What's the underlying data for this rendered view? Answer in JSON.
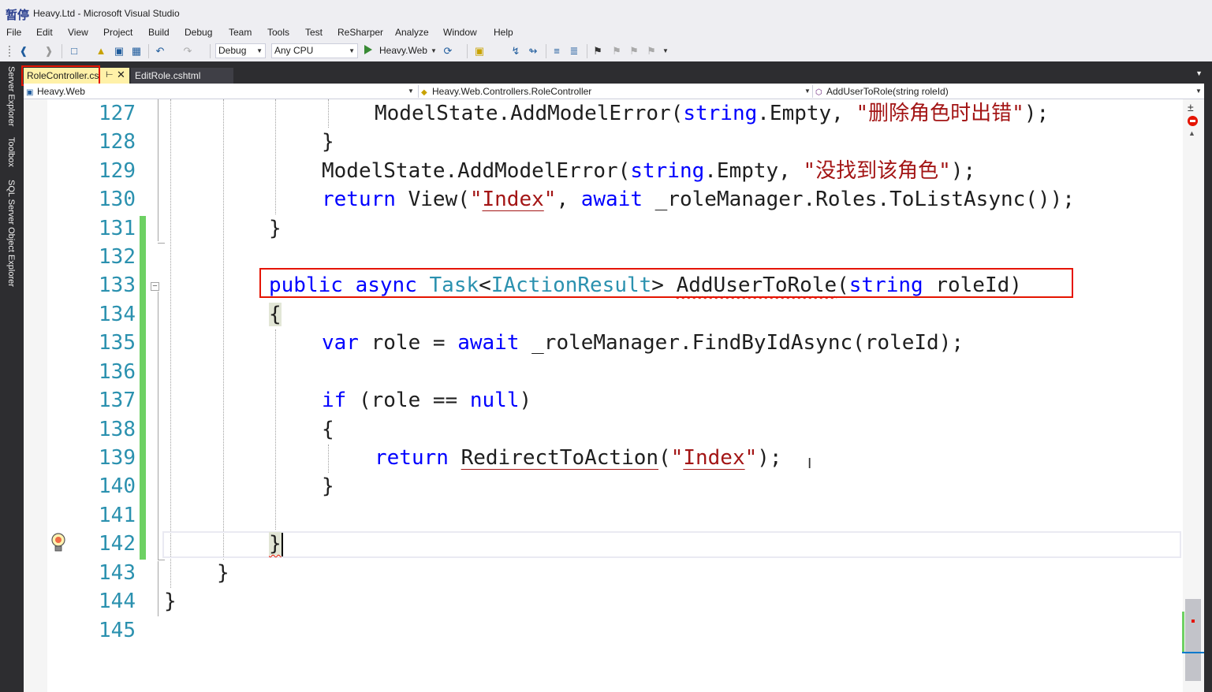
{
  "window": {
    "title": "Heavy.Ltd - Microsoft Visual Studio",
    "logo_text": "暂停"
  },
  "menu": [
    "File",
    "Edit",
    "View",
    "Project",
    "Build",
    "Debug",
    "Team",
    "Tools",
    "Test",
    "ReSharper",
    "Analyze",
    "Window",
    "Help"
  ],
  "toolbar": {
    "configuration": "Debug",
    "platform": "Any CPU",
    "run_target": "Heavy.Web"
  },
  "sidebar": {
    "tabs": [
      "Server Explorer",
      "Toolbox",
      "SQL Server Object Explorer"
    ]
  },
  "tabs": [
    {
      "label": "RoleController.cs",
      "active": true
    },
    {
      "label": "EditRole.cshtml",
      "active": false
    }
  ],
  "navigation": {
    "project": "Heavy.Web",
    "type": "Heavy.Web.Controllers.RoleController",
    "member": "AddUserToRole(string roleId)"
  },
  "editor": {
    "line_numbers": [
      "127",
      "128",
      "129",
      "130",
      "131",
      "132",
      "133",
      "134",
      "135",
      "136",
      "137",
      "138",
      "139",
      "140",
      "141",
      "142",
      "143",
      "144",
      "145"
    ],
    "text": {
      "l127_a": "ModelState.AddModelError(",
      "l127_kw": "string",
      "l127_b": ".Empty, ",
      "l127_str": "\"删除角色时出错\"",
      "l127_c": ");",
      "l128": "}",
      "l129_a": "ModelState.AddModelError(",
      "l129_kw": "string",
      "l129_b": ".Empty, ",
      "l129_str": "\"没找到该角色\"",
      "l129_c": ");",
      "l130_kw": "return",
      "l130_a": " View(",
      "l130_q1": "\"",
      "l130_str": "Index",
      "l130_q2": "\"",
      "l130_b": ", ",
      "l130_kw2": "await",
      "l130_c": " _roleManager.Roles.ToListAsync());",
      "l131": "}",
      "l133_kw1": "public",
      "l133_kw2": "async",
      "l133_ty1": "Task",
      "l133_lt": "<",
      "l133_ty2": "IActionResult",
      "l133_gt": "> ",
      "l133_name": "AddUserToRole",
      "l133_paren": "(",
      "l133_kw3": "string",
      "l133_param": " roleId)",
      "l134": "{",
      "l135_kw1": "var",
      "l135_a": " role = ",
      "l135_kw2": "await",
      "l135_b": " _roleManager.FindByIdAsync(roleId);",
      "l137_kw1": "if",
      "l137_a": " (role == ",
      "l137_kw2": "null",
      "l137_b": ")",
      "l138": "{",
      "l139_kw": "return",
      "l139_sp": " ",
      "l139_name": "RedirectToAction",
      "l139_paren": "(",
      "l139_q1": "\"",
      "l139_str": "Index",
      "l139_q2": "\"",
      "l139_c": ");",
      "l140": "}",
      "l142": "}",
      "l143": "}",
      "l144": "}"
    }
  },
  "colors": {
    "keyword": "#0000ff",
    "type": "#2b91af",
    "string": "#a31515",
    "line_number": "#2b91af",
    "highlight_box": "#e51400",
    "changed_lines": "#6dd163",
    "chrome_dark": "#2d2d30",
    "active_tab": "#fff1a8"
  }
}
